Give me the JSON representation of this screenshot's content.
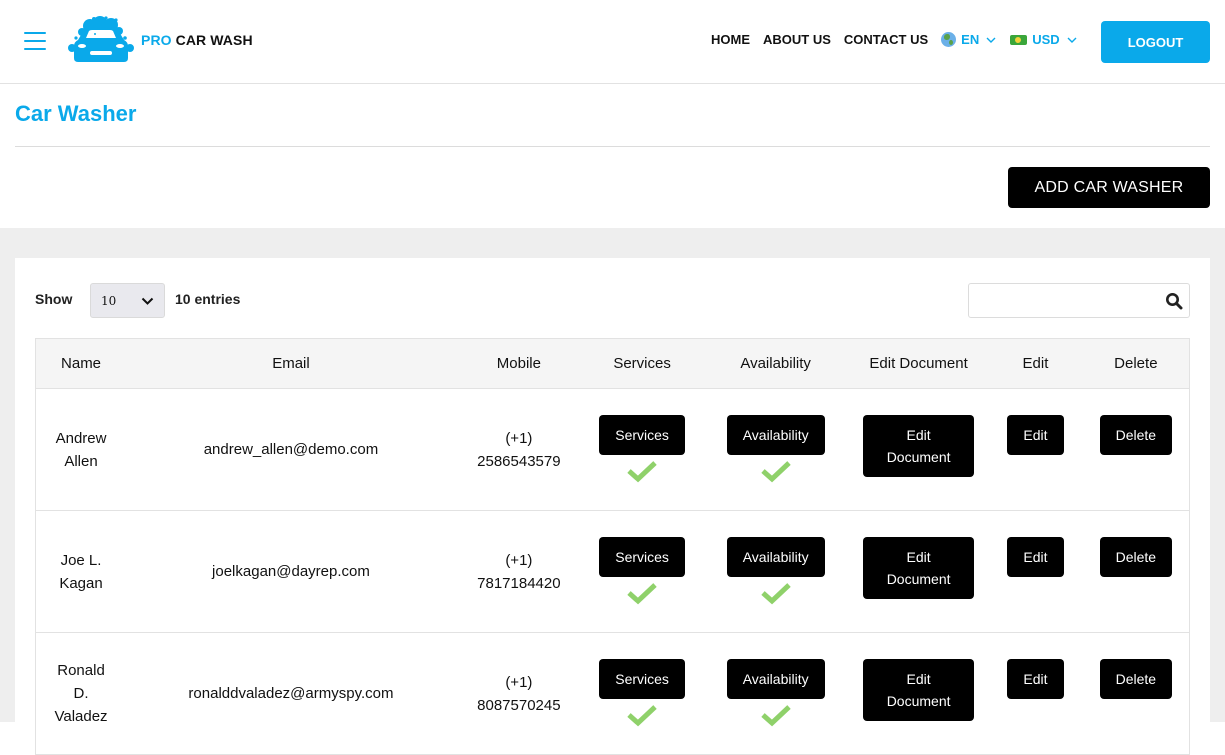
{
  "header": {
    "brand_pro": "PRO",
    "brand_rest": " CAR WASH",
    "nav": [
      {
        "label": "HOME"
      },
      {
        "label": "ABOUT US"
      },
      {
        "label": "CONTACT US"
      }
    ],
    "language": {
      "icon": "globe-icon",
      "value": "EN"
    },
    "currency": {
      "icon": "banknote-icon",
      "value": "USD"
    },
    "logout_label": "LOGOUT"
  },
  "page": {
    "title": "Car Washer",
    "add_button_label": "ADD CAR WASHER"
  },
  "table_controls": {
    "show_label": "Show",
    "page_length": "10",
    "entries_label": "10 entries",
    "search_value": "",
    "search_placeholder": ""
  },
  "table": {
    "columns": [
      "Name",
      "Email",
      "Mobile",
      "Services",
      "Availability",
      "Edit Document",
      "Edit",
      "Delete"
    ],
    "rows": [
      {
        "name": "Andrew Allen",
        "email": "andrew_allen@demo.com",
        "mobile_code": "(+1)",
        "mobile_number": "2586543579",
        "services_label": "Services",
        "services_ok": true,
        "availability_label": "Availability",
        "availability_ok": true,
        "edit_document_label": "Edit Document",
        "edit_label": "Edit",
        "delete_label": "Delete"
      },
      {
        "name": "Joe L. Kagan",
        "email": "joelkagan@dayrep.com",
        "mobile_code": "(+1)",
        "mobile_number": "7817184420",
        "services_label": "Services",
        "services_ok": true,
        "availability_label": "Availability",
        "availability_ok": true,
        "edit_document_label": "Edit Document",
        "edit_label": "Edit",
        "delete_label": "Delete"
      },
      {
        "name": "Ronald D. Valadez",
        "email": "ronalddvaladez@armyspy.com",
        "mobile_code": "(+1)",
        "mobile_number": "8087570245",
        "services_label": "Services",
        "services_ok": true,
        "availability_label": "Availability",
        "availability_ok": true,
        "edit_document_label": "Edit Document",
        "edit_label": "Edit",
        "delete_label": "Delete"
      }
    ]
  },
  "colors": {
    "accent": "#0aa9ea",
    "button_dark": "#000000",
    "check_green": "#8fd16a",
    "page_grey": "#eeeeee"
  }
}
